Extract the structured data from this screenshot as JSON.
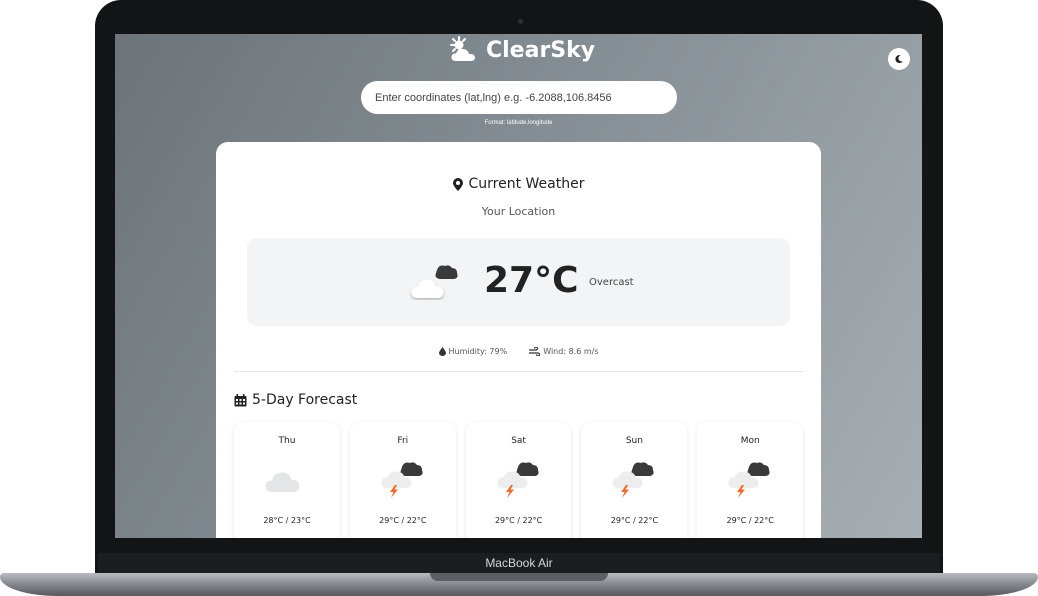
{
  "device": {
    "label": "MacBook Air"
  },
  "app": {
    "name": "ClearSky",
    "theme_toggle_icon": "moon-icon"
  },
  "search": {
    "placeholder": "Enter coordinates (lat,lng) e.g. -6.2088,106.8456",
    "value": "",
    "hint": "Format: latitude,longitude"
  },
  "current": {
    "title": "Current Weather",
    "location": "Your Location",
    "temperature": "27°C",
    "condition": "Overcast",
    "icon": "overcast-cloud-icon",
    "humidity": "Humidity: 79%",
    "wind": "Wind: 8.6 m/s"
  },
  "forecast": {
    "title": "5-Day Forecast",
    "days": [
      {
        "day": "Thu",
        "temp": "28°C / 23°C",
        "icon": "cloud-icon"
      },
      {
        "day": "Fri",
        "temp": "29°C / 22°C",
        "icon": "thunderstorm-icon"
      },
      {
        "day": "Sat",
        "temp": "29°C / 22°C",
        "icon": "thunderstorm-icon"
      },
      {
        "day": "Sun",
        "temp": "29°C / 22°C",
        "icon": "thunderstorm-icon"
      },
      {
        "day": "Mon",
        "temp": "29°C / 22°C",
        "icon": "thunderstorm-icon"
      }
    ]
  },
  "colors": {
    "accent_bolt": "#f26b2a",
    "background_gradient_start": "#6c7479",
    "background_gradient_end": "#a7afb4"
  }
}
